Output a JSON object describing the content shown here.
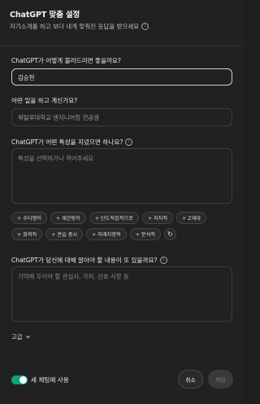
{
  "header": {
    "title": "ChatGPT 맞춤 설정",
    "subtitle": "자기소개를 하고 보다 내게 맞춰진 응답을 받으세요",
    "info_icon": "info-icon"
  },
  "sections": {
    "name": {
      "label": "ChatGPT가 어떻게 불러드리면 좋을까요?",
      "value": "김승현"
    },
    "job": {
      "label": "어떤 일을 하고 계신가요?",
      "value": "워털루대학교 엔지니어링 전공생"
    },
    "traits": {
      "label": "ChatGPT가 어떤 특성을 지녔으면 하나요?",
      "placeholder": "특성을 선택하거나 적어주세요"
    },
    "more": {
      "label": "ChatGPT가 당신에 대해 알아야 할 내용이 또 있을까요?",
      "placeholder": "기억해 두어야 할 관심사, 가치, 선호 사항 등"
    }
  },
  "chips": {
    "row1": [
      "+ 수다쟁이",
      "+ 재간둥이",
      "+ 단도직입적으로",
      "+ 지지적",
      "+ Z세대"
    ],
    "row2": [
      "+ 회의적",
      "+ 관습 중시",
      "+ 미래지향적",
      "+ 분석적"
    ],
    "refresh_icon": "refresh-icon"
  },
  "advanced": {
    "label": "고급",
    "icon": "chevron-down-icon"
  },
  "footer": {
    "toggle_label": "새 채팅에 사용",
    "toggle_on": true,
    "cancel": "취소",
    "save": "저장"
  },
  "colors": {
    "accent": "#10a37f",
    "background": "#212121"
  }
}
